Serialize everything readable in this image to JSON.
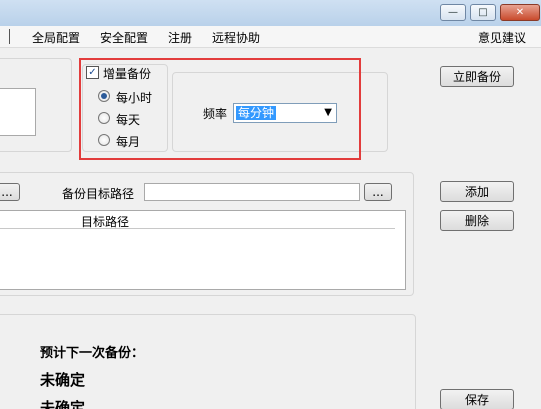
{
  "window": {
    "minimize_glyph": "—",
    "maximize_glyph": "□",
    "close_glyph": "✕"
  },
  "menu": {
    "items": [
      "全局配置",
      "安全配置",
      "注册",
      "远程协助"
    ],
    "feedback": "意见建议"
  },
  "incremental": {
    "checkbox_label": "增量备份",
    "checked": true,
    "checkmark": "✓",
    "options": [
      "每小时",
      "每天",
      "每月"
    ],
    "selected_index": 0
  },
  "frequency": {
    "label": "频率",
    "value": "每分钟",
    "arrow": "▼"
  },
  "buttons": {
    "backup_now": "立即备份",
    "add": "添加",
    "delete": "删除",
    "save": "保存",
    "browse_left": "...",
    "browse_right": "..."
  },
  "target": {
    "label": "备份目标路径",
    "value": "",
    "column_header": "目标路径"
  },
  "schedule": {
    "next_label": "预计下一次备份：",
    "line1": "未确定",
    "line2": "未确定"
  }
}
